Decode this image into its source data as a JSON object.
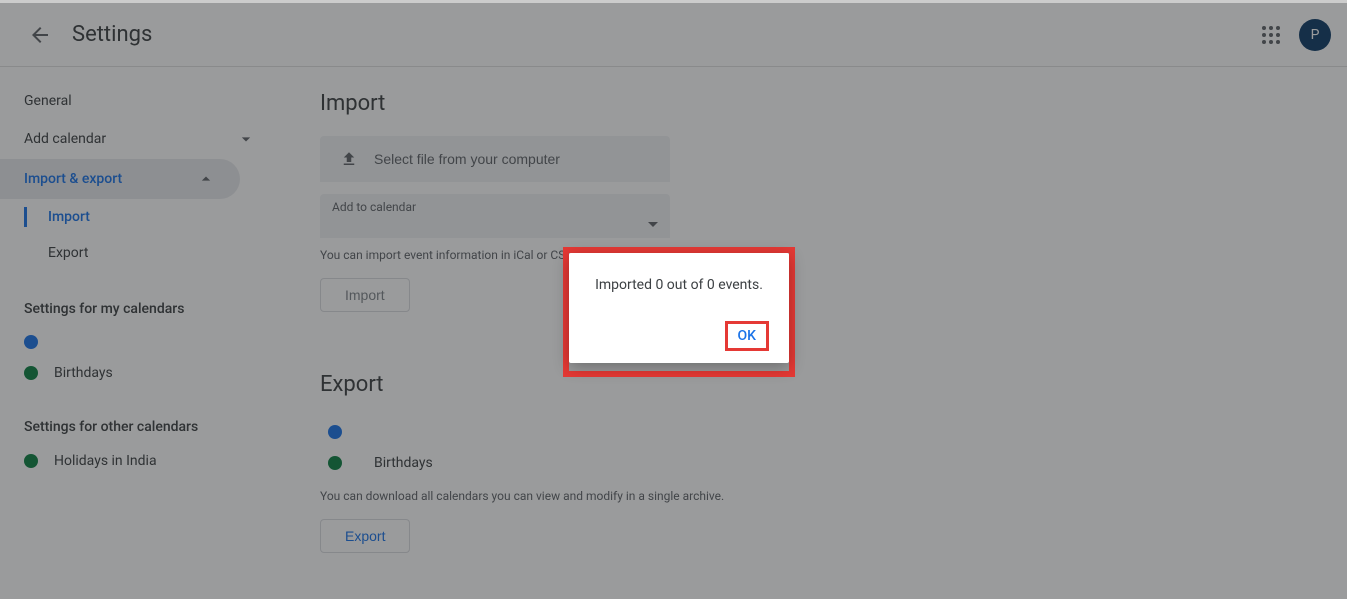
{
  "header": {
    "title": "Settings",
    "avatar_letter": "P"
  },
  "sidebar": {
    "general": "General",
    "add_calendar": "Add calendar",
    "import_export": "Import & export",
    "sub_import": "Import",
    "sub_export": "Export",
    "section_my": "Settings for my calendars",
    "my_cals": {
      "c0": {
        "label": ""
      },
      "c1": {
        "label": "Birthdays"
      }
    },
    "section_other": "Settings for other calendars",
    "other_cals": {
      "c0": {
        "label": "Holidays in India"
      }
    }
  },
  "main": {
    "import_title": "Import",
    "file_button": "Select file from your computer",
    "add_to_label": "Add to calendar",
    "add_to_value": "",
    "import_help": "You can import event information in iCal or CSV (MS Outlook) format.",
    "import_btn": "Import",
    "export_title": "Export",
    "export_cals": {
      "c0": {
        "label": ""
      },
      "c1": {
        "label": "Birthdays"
      }
    },
    "export_help": "You can download all calendars you can view and modify in a single archive.",
    "export_btn": "Export"
  },
  "dialog": {
    "message": "Imported 0 out of 0 events.",
    "ok": "OK"
  }
}
